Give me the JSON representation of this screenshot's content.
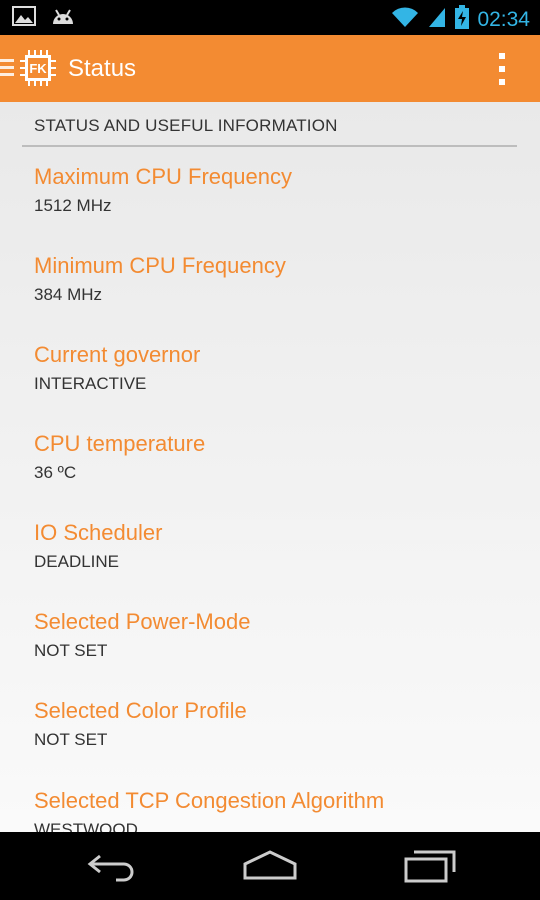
{
  "status_bar": {
    "time": "02:34",
    "left_icons": [
      "gallery-icon",
      "android-debug-icon"
    ],
    "right_icons": [
      "wifi-icon",
      "cell-signal-icon",
      "battery-charging-icon"
    ]
  },
  "action_bar": {
    "logo_text": "FK",
    "title": "Status",
    "overflow_icon": "overflow-menu-icon"
  },
  "section": {
    "header": "STATUS AND USEFUL INFORMATION"
  },
  "items": [
    {
      "label": "Maximum CPU Frequency",
      "value": "1512 MHz"
    },
    {
      "label": "Minimum CPU Frequency",
      "value": "384 MHz"
    },
    {
      "label": "Current governor",
      "value": "INTERACTIVE"
    },
    {
      "label": "CPU temperature",
      "value": "36 ºC"
    },
    {
      "label": "IO Scheduler",
      "value": "DEADLINE"
    },
    {
      "label": "Selected Power-Mode",
      "value": "NOT SET"
    },
    {
      "label": "Selected Color Profile",
      "value": "NOT SET"
    },
    {
      "label": "Selected TCP Congestion Algorithm",
      "value": "WESTWOOD"
    }
  ],
  "nav_bar": {
    "buttons": [
      "back-icon",
      "home-icon",
      "recents-icon"
    ]
  },
  "colors": {
    "accent": "#f38b32",
    "clock": "#33b5e5"
  }
}
